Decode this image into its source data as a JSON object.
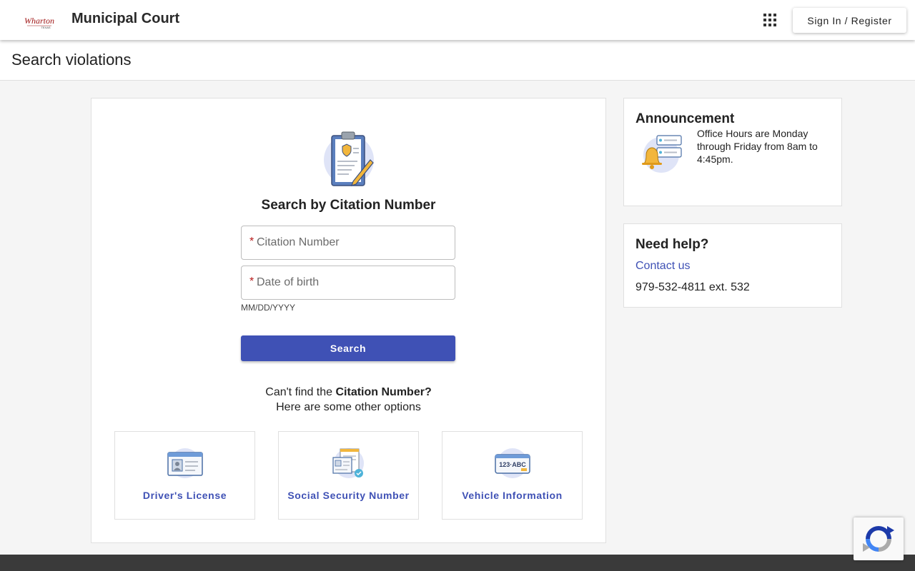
{
  "header": {
    "logo_text": "Wharton",
    "logo_subtext": "TEXAS",
    "app_title": "Municipal Court",
    "signin_label": "Sign In / Register"
  },
  "page": {
    "title": "Search violations"
  },
  "search": {
    "heading": "Search by Citation Number",
    "citation_placeholder": "Citation Number",
    "citation_value": "",
    "dob_placeholder": "Date of birth",
    "dob_value": "",
    "dob_hint": "MM/DD/YYYY",
    "required_marker": "*",
    "button_label": "Search"
  },
  "alternatives": {
    "prefix": "Can't find the ",
    "emphasis": "Citation Number?",
    "line2": "Here are some other options",
    "options": [
      {
        "label": "Driver's License",
        "icon": "id-card-icon"
      },
      {
        "label": "Social Security Number",
        "icon": "documents-icon"
      },
      {
        "label": "Vehicle Information",
        "icon": "license-plate-icon"
      }
    ],
    "plate_text": "123·ABC"
  },
  "announcement": {
    "title": "Announcement",
    "text": "Office Hours are Monday through Friday from 8am to 4:45pm."
  },
  "help": {
    "title": "Need help?",
    "contact_label": "Contact us",
    "phone": "979-532-4811 ext. 532"
  },
  "colors": {
    "primary": "#3f51b5",
    "required": "#b71c1c",
    "footer": "#3a3a3a"
  }
}
